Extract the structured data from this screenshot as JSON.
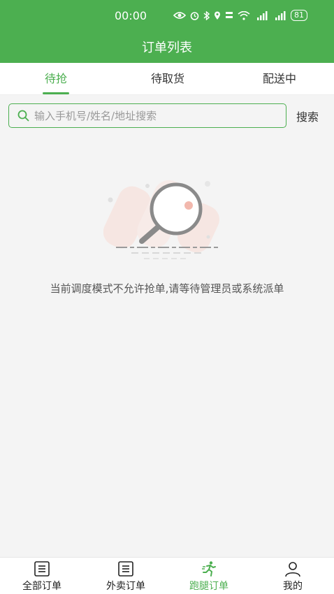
{
  "status_bar": {
    "time": "00:00",
    "battery": "81"
  },
  "header": {
    "title": "订单列表"
  },
  "tabs": [
    {
      "label": "待抢",
      "active": true
    },
    {
      "label": "待取货",
      "active": false
    },
    {
      "label": "配送中",
      "active": false
    }
  ],
  "search": {
    "placeholder": "输入手机号/姓名/地址搜索",
    "value": "",
    "button_label": "搜索"
  },
  "empty_state": {
    "message": "当前调度模式不允许抢单,请等待管理员或系统派单"
  },
  "bottom_nav": [
    {
      "label": "全部订单",
      "icon": "order-list-icon",
      "active": false
    },
    {
      "label": "外卖订单",
      "icon": "order-list-icon",
      "active": false
    },
    {
      "label": "跑腿订单",
      "icon": "runner-icon",
      "active": true
    },
    {
      "label": "我的",
      "icon": "user-icon",
      "active": false
    }
  ],
  "colors": {
    "primary": "#4caf50",
    "background": "#f4f4f4"
  }
}
